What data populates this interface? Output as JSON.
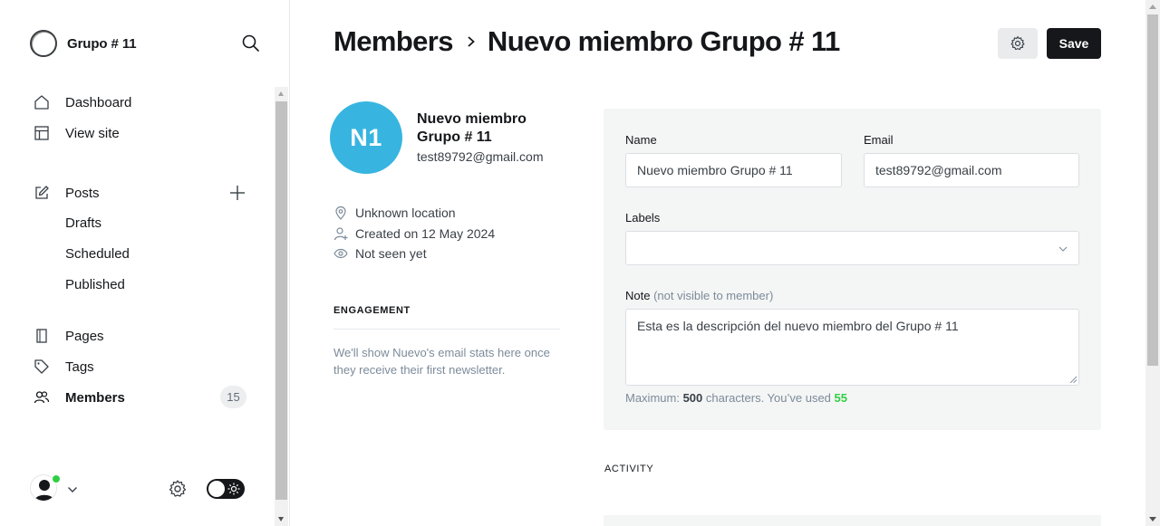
{
  "brand": {
    "name": "Grupo # 11"
  },
  "sidebar": {
    "items": [
      {
        "label": "Dashboard",
        "icon": "home-icon"
      },
      {
        "label": "View site",
        "icon": "layout-icon"
      },
      {
        "label": "Posts",
        "icon": "edit-icon"
      },
      {
        "label": "Drafts"
      },
      {
        "label": "Scheduled"
      },
      {
        "label": "Published"
      },
      {
        "label": "Pages",
        "icon": "pages-icon"
      },
      {
        "label": "Tags",
        "icon": "tag-icon"
      },
      {
        "label": "Members",
        "icon": "members-icon",
        "count": "15"
      }
    ]
  },
  "header": {
    "breadcrumb_parent": "Members",
    "breadcrumb_current": "Nuevo miembro Grupo # 11",
    "save_label": "Save"
  },
  "member": {
    "initials": "N1",
    "name": "Nuevo miembro Grupo # 11",
    "email": "test89792@gmail.com",
    "location": "Unknown location",
    "created": "Created on 12 May 2024",
    "last_seen": "Not seen yet"
  },
  "engagement": {
    "title": "ENGAGEMENT",
    "text": "We'll show Nuevo's email stats here once they receive their first newsletter."
  },
  "form": {
    "name_label": "Name",
    "name_value": "Nuevo miembro Grupo # 11",
    "email_label": "Email",
    "email_value": "test89792@gmail.com",
    "labels_label": "Labels",
    "labels_value": "",
    "note_label": "Note",
    "note_hint": "(not visible to member)",
    "note_value": "Esta es la descripción del nuevo miembro del Grupo # 11",
    "counter_prefix": "Maximum: ",
    "counter_max": "500",
    "counter_mid": " characters. You’ve used ",
    "counter_used": "55"
  },
  "activity": {
    "title": "ACTIVITY"
  },
  "colors": {
    "avatar_bg": "#37b5e0",
    "primary_button": "#15171a",
    "panel_bg": "#f4f5f5",
    "online": "#30cf43",
    "counter_used": "#30cf43"
  }
}
